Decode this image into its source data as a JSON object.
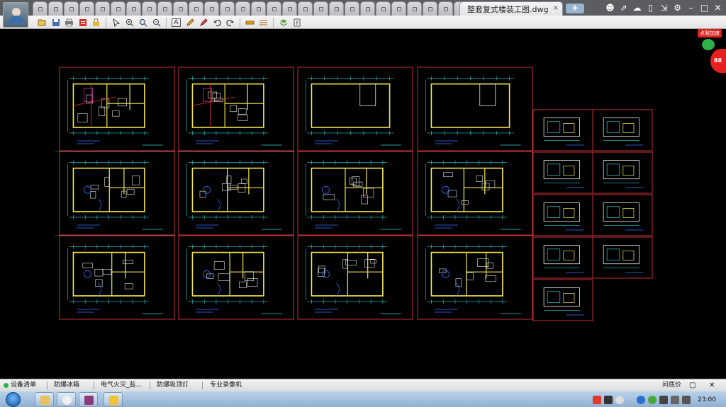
{
  "window": {
    "active_tab_title": "整套复式楼装工图.dwg",
    "close_tab_glyph": "×",
    "new_tab_label": "+",
    "mini_tab_count": 28,
    "controls": [
      "user-icon",
      "share-icon",
      "cloud-icon",
      "phone-icon",
      "export-icon",
      "settings-icon",
      "minimize-icon",
      "maximize-icon",
      "close-icon"
    ]
  },
  "toolbar": {
    "text_tool_label": "A",
    "icons": [
      "open-icon",
      "save-icon",
      "print-icon",
      "pdf-icon",
      "lock-icon",
      "select-icon",
      "zoom-in-icon",
      "zoom-window-icon",
      "zoom-out-icon",
      "text-icon",
      "pencil-icon",
      "highlight-icon",
      "undo-icon",
      "redo-icon",
      "measure-icon",
      "dimension-icon",
      "layers-icon",
      "notes-icon"
    ]
  },
  "promo": {
    "tag": "点我加速",
    "badge": "88"
  },
  "appbar": {
    "items": [
      "设备清单",
      "防爆冰箱",
      "电气火灾_监...",
      "防爆吸顶灯",
      "专业录像机"
    ],
    "right_label": "问底价"
  },
  "taskbar": {
    "clock": "23:00"
  },
  "colors": {
    "sheet_border": "#c0303a",
    "wall": "#f5e84a",
    "dimension": "#2fd0d0",
    "annotation": "#3a6fff",
    "furniture": "#e8e8e8"
  }
}
